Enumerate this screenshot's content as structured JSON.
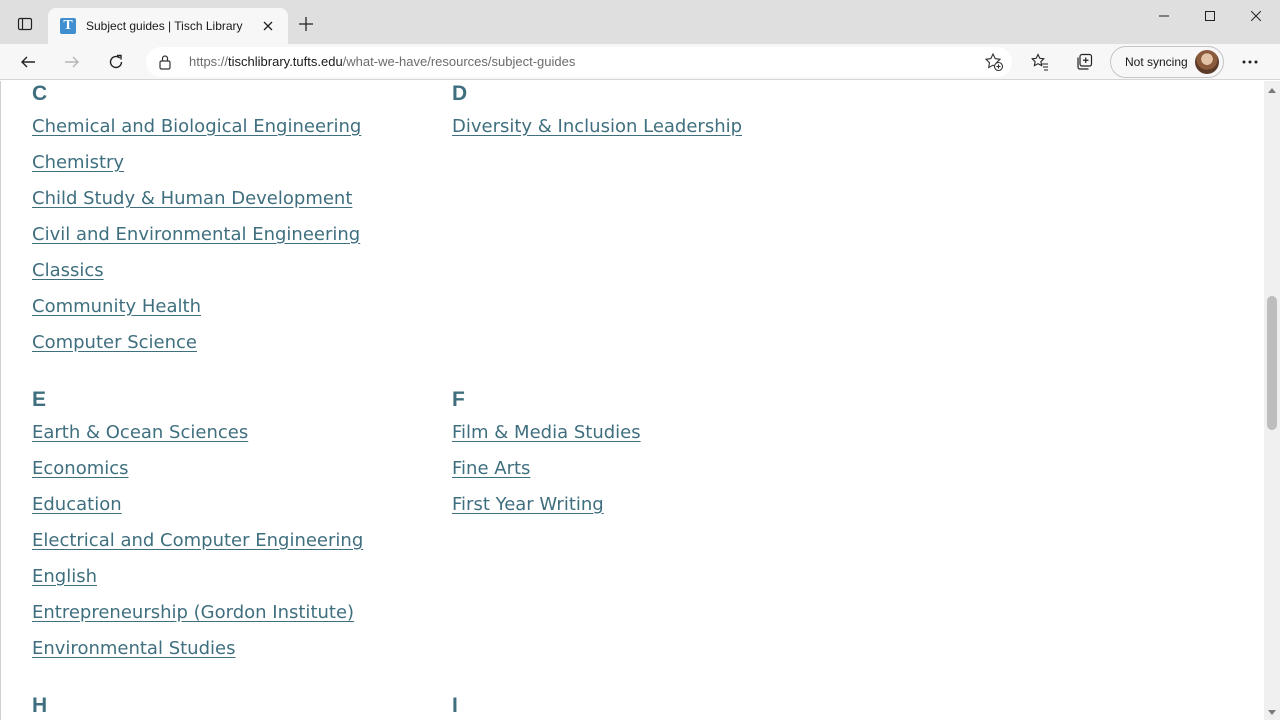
{
  "browser": {
    "tab_title": "Subject guides | Tisch Library",
    "favicon_letter": "T",
    "url_host": "tischlibrary.tufts.edu",
    "url_prefix": "https://",
    "url_path": "/what-we-have/resources/subject-guides",
    "sync_label": "Not syncing"
  },
  "page": {
    "link_color": "#3f6f7f",
    "groups": [
      {
        "letter": "C",
        "items": [
          "Chemical and Biological Engineering",
          "Chemistry",
          "Child Study & Human Development",
          "Civil and Environmental Engineering",
          "Classics",
          "Community Health",
          "Computer Science"
        ]
      },
      {
        "letter": "D",
        "items": [
          "Diversity & Inclusion Leadership"
        ]
      },
      {
        "letter": "E",
        "items": [
          "Earth & Ocean Sciences",
          "Economics",
          "Education",
          "Electrical and Computer Engineering",
          "English",
          "Entrepreneurship (Gordon Institute)",
          "Environmental Studies"
        ]
      },
      {
        "letter": "F",
        "items": [
          "Film & Media Studies",
          "Fine Arts",
          "First Year Writing"
        ]
      },
      {
        "letter": "H",
        "items": []
      },
      {
        "letter": "I",
        "items": []
      }
    ]
  }
}
